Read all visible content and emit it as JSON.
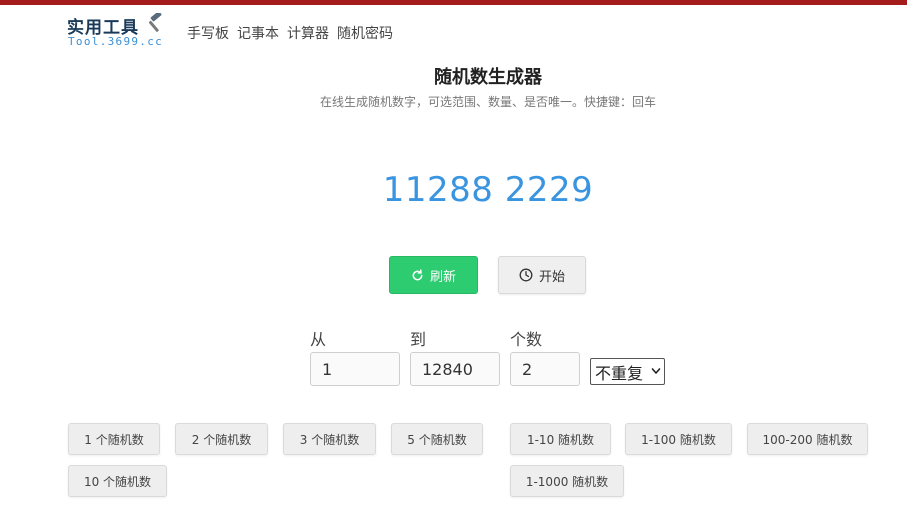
{
  "header": {
    "logo_title": "实用工具",
    "logo_sub": "Tool.3699.cc",
    "nav": [
      "手写板",
      "记事本",
      "计算器",
      "随机密码"
    ]
  },
  "main": {
    "title": "随机数生成器",
    "subtitle": "在线生成随机数字，可选范围、数量、是否唯一。快捷键：回车",
    "result": "11288 2229",
    "refresh_label": "刷新",
    "start_label": "开始"
  },
  "form": {
    "from_label": "从",
    "to_label": "到",
    "count_label": "个数",
    "from_value": "1",
    "to_value": "12840",
    "count_value": "2",
    "unique_selected": "不重复"
  },
  "quick_count": [
    "1 个随机数",
    "2 个随机数",
    "3 个随机数",
    "5 个随机数",
    "10 个随机数"
  ],
  "quick_range": [
    "1-10 随机数",
    "1-100 随机数",
    "100-200 随机数",
    "1-1000 随机数"
  ],
  "colors": {
    "top_bar": "#a51c1c",
    "result": "#3a95e0",
    "refresh_button": "#2ecc71",
    "logo_sub": "#3a8fd6"
  },
  "icons": {
    "logo": "hammer-icon",
    "refresh": "refresh-icon",
    "start": "clock-icon",
    "select": "chevron-down-icon"
  }
}
